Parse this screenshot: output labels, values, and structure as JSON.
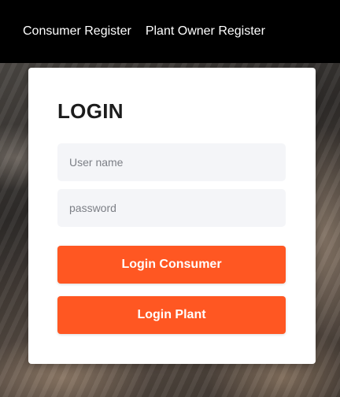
{
  "nav": {
    "links": [
      {
        "label": "Consumer Register"
      },
      {
        "label": "Plant Owner Register"
      }
    ]
  },
  "login": {
    "title": "LOGIN",
    "username_placeholder": "User name",
    "password_placeholder": "password",
    "consumer_button": "Login Consumer",
    "plant_button": "Login Plant"
  },
  "colors": {
    "navbar": "#000000",
    "accent": "#ff5722",
    "input_background": "#f4f5f8"
  }
}
